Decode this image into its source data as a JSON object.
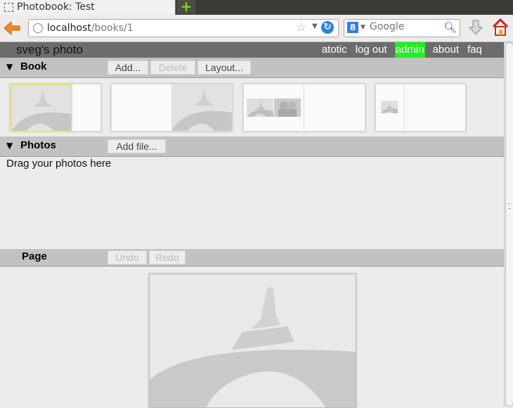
{
  "browser": {
    "tab_title": "Photobook: Test",
    "new_tab": "+",
    "url_host": "localhost",
    "url_path": "/books/1",
    "search_placeholder": "Google"
  },
  "app": {
    "title": "sveg's photo",
    "nav": [
      "atotic",
      "log out",
      "admin",
      "about",
      "faq"
    ],
    "active_nav": "admin",
    "active_color": "#22ee22"
  },
  "book": {
    "title": "Book",
    "add": "Add...",
    "delete": "Delete",
    "layout": "Layout..."
  },
  "photos": {
    "title": "Photos",
    "add_file": "Add file...",
    "drag_hint": "Drag your photos here"
  },
  "page": {
    "title": "Page",
    "undo": "Undo",
    "redo": "Redo"
  },
  "icons": [
    "back-arrow-icon",
    "globe-icon",
    "star-icon",
    "reload-icon",
    "google-icon",
    "search-icon",
    "download-icon",
    "home-icon",
    "triangle-down-icon"
  ]
}
